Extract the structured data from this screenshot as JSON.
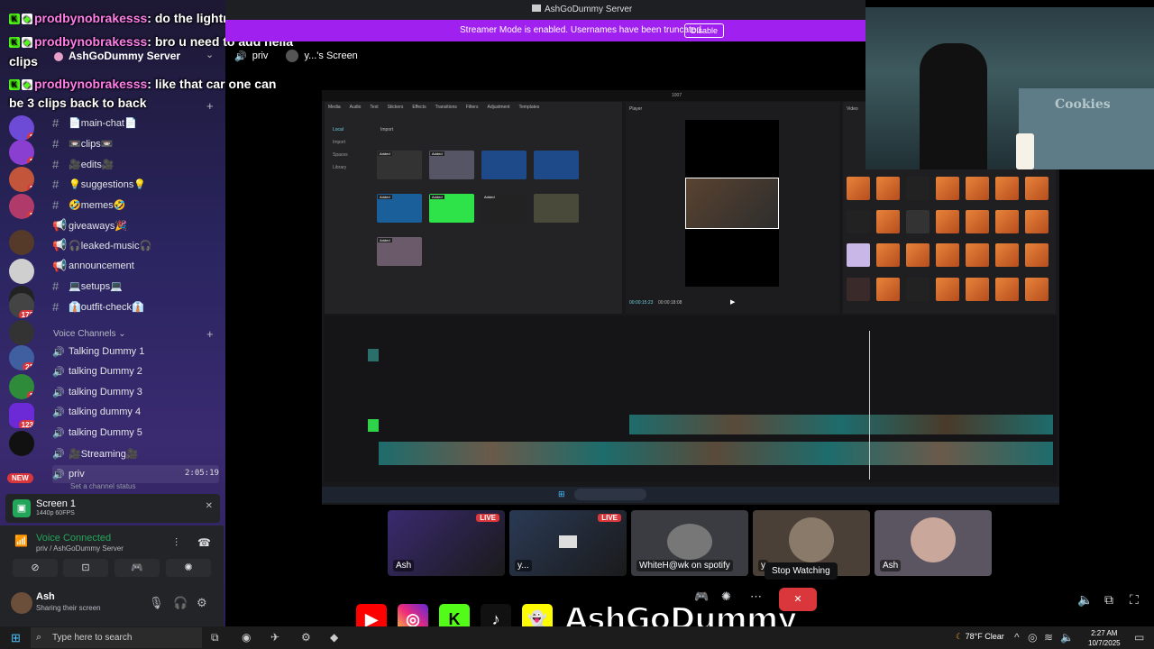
{
  "app": {
    "title": "AshGoDummy Server"
  },
  "streamer_mode": {
    "message": "Streamer Mode is enabled. Usernames have been truncated.",
    "disable_label": "Disable"
  },
  "server": {
    "name": "AshGoDummy Server",
    "text_channels": [
      {
        "name": "📄main-chat📄"
      },
      {
        "name": "📼clips📼"
      },
      {
        "name": "🎥edits🎥"
      },
      {
        "name": "💡suggestions💡"
      },
      {
        "name": "🤣memes🤣"
      },
      {
        "name": "giveaways🎉"
      },
      {
        "name": "🎧leaked-music🎧"
      },
      {
        "name": "announcement"
      },
      {
        "name": "💻setups💻"
      },
      {
        "name": "👔outfit-check👔"
      }
    ],
    "voice_section_label": "Voice Channels",
    "voice_channels": [
      {
        "name": "Talking Dummy 1"
      },
      {
        "name": "talking Dummy 2"
      },
      {
        "name": "talking Dummy 3"
      },
      {
        "name": "talking dummy 4"
      },
      {
        "name": "talking Dummy 5"
      },
      {
        "name": "🎥Streaming🎥"
      },
      {
        "name": "priv"
      }
    ],
    "priv_time": "2:05:19",
    "priv_status": "Set a channel status"
  },
  "rail_badges": [
    "1",
    "1",
    "1",
    "1",
    "1",
    "172",
    "21",
    "1",
    "123"
  ],
  "rail_new": "NEW",
  "chat": [
    {
      "user": "prodbynobrakesss",
      "text": ": do the lightning"
    },
    {
      "user": "prodbynobrakesss",
      "text": ": bro u need to add hella"
    },
    {
      "user": "",
      "text": "clips"
    },
    {
      "user": "prodbynobrakesss",
      "text": ": like that car one can"
    },
    {
      "user": "",
      "text": "be 3 clips back to back"
    }
  ],
  "stage": {
    "channel": "priv",
    "screen_label": "y...'s Screen"
  },
  "screen_share": {
    "title": "Screen 1",
    "subtitle": "1440p 60FPS"
  },
  "voice": {
    "status": "Voice Connected",
    "location": "priv / AshGoDummy Server"
  },
  "user": {
    "name": "Ash",
    "status": "Sharing their screen"
  },
  "tiles": [
    {
      "label": "Ash",
      "live": "LIVE"
    },
    {
      "label": "y...",
      "live": "LIVE"
    },
    {
      "label": "WhiteH@wk on spotify",
      "live": ""
    },
    {
      "label": "y",
      "live": ""
    },
    {
      "label": "Ash",
      "live": ""
    }
  ],
  "tooltip": "Stop Watching",
  "brand": {
    "name": "AshGoDummy"
  },
  "editor": {
    "project": "1007",
    "tabs": [
      "Media",
      "Audio",
      "Text",
      "Stickers",
      "Effects",
      "Transitions",
      "Filters",
      "Adjustment",
      "Templates"
    ],
    "side": [
      "Local",
      "Import",
      "Spaces",
      "Library"
    ],
    "import_label": "Import",
    "player_label": "Player",
    "fx_label": "Video",
    "time_current": "00:00:15:23",
    "time_total": "00:00:18:08",
    "added_tag": "Added"
  },
  "taskbar": {
    "search_placeholder": "Type here to search",
    "weather": "78°F  Clear",
    "time": "2:27 AM",
    "date": "10/7/2025"
  },
  "colors": {
    "accent": "#a020f0",
    "live": "#da373c",
    "connected": "#23a55a",
    "username": "#ff7de9"
  }
}
